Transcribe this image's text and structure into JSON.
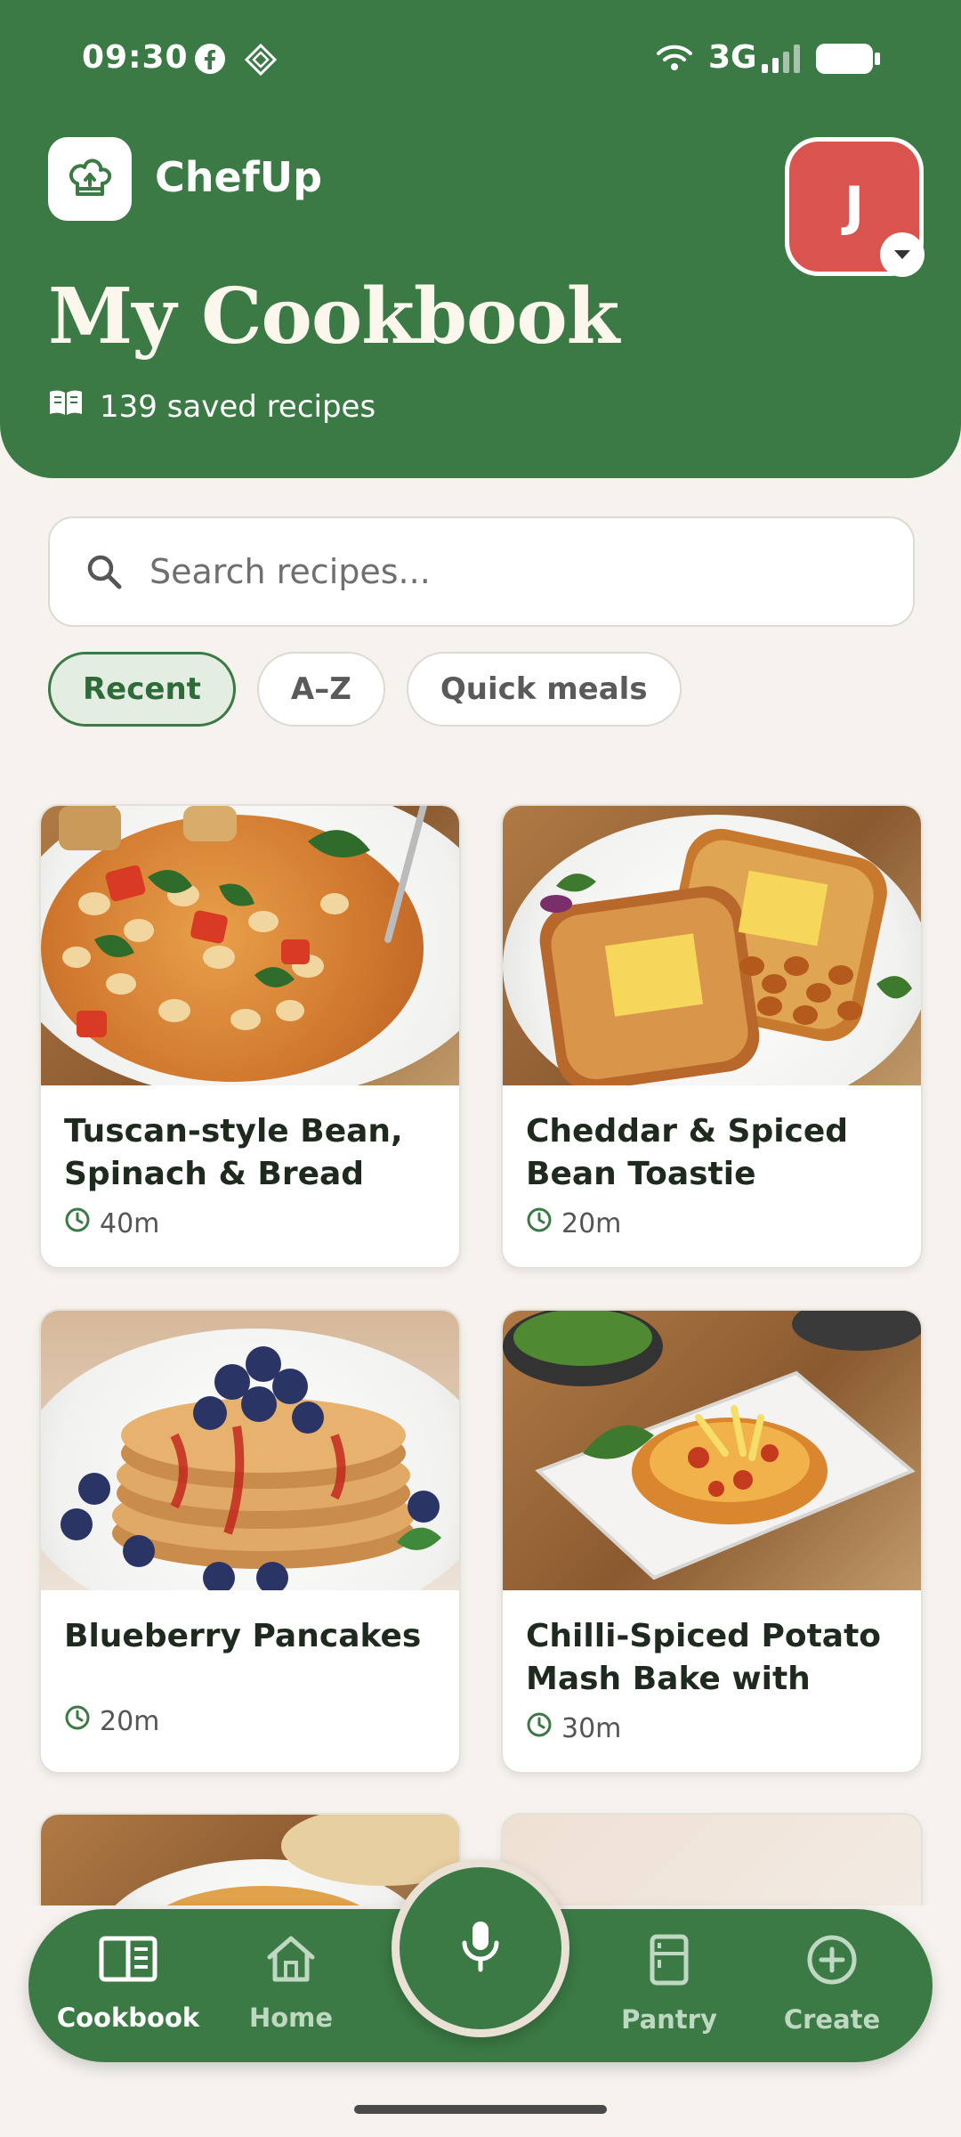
{
  "status_bar": {
    "time": "09:30",
    "network": "3G"
  },
  "app": {
    "brand_name": "ChefUp"
  },
  "user": {
    "avatar_initial": "J"
  },
  "header": {
    "title": "My Cookbook",
    "recipe_count": "139 saved recipes"
  },
  "search": {
    "placeholder": "Search recipes..."
  },
  "filters": [
    {
      "label": "Recent",
      "active": true
    },
    {
      "label": "A–Z",
      "active": false
    },
    {
      "label": "Quick meals",
      "active": false
    }
  ],
  "recipes": [
    {
      "title": "Tuscan-style Bean, Spinach & Bread Soup…",
      "time": "40m"
    },
    {
      "title": "Cheddar & Spiced Bean Toastie",
      "time": "20m"
    },
    {
      "title": "Blueberry Pancakes",
      "time": "20m"
    },
    {
      "title": "Chilli-Spiced Potato Mash Bake with Ched…",
      "time": "30m"
    }
  ],
  "bottom_nav": {
    "items": [
      {
        "label": "Cookbook",
        "icon": "book-icon",
        "active": true
      },
      {
        "label": "Home",
        "icon": "home-icon",
        "active": false
      },
      {
        "label": "Pantry",
        "icon": "fridge-icon",
        "active": false
      },
      {
        "label": "Create",
        "icon": "plus-circle-icon",
        "active": false
      }
    ],
    "center_action": "microphone-icon"
  },
  "colors": {
    "primary_green": "#3b7a45",
    "background": "#f6f3ee",
    "avatar_red": "#d9544f",
    "title_cream": "#fbf7ec"
  }
}
